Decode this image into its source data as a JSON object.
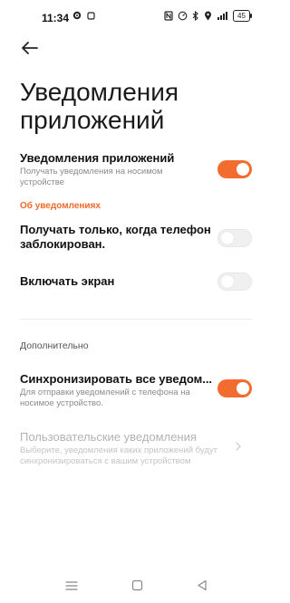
{
  "status_bar": {
    "time": "11:34",
    "battery": "45",
    "icons": [
      "gear-icon",
      "square-icon",
      "nfc-icon",
      "speedometer-icon",
      "bluetooth-icon",
      "location-icon",
      "signal-icon"
    ]
  },
  "header": {
    "title": "Уведомления приложений"
  },
  "settings": {
    "app_notifications": {
      "title": "Уведомления приложений",
      "subtitle_line1": "Получать уведомления на носимом",
      "subtitle_line2": "устройстве",
      "enabled": true
    },
    "section_about": "Об уведомлениях",
    "only_when_locked": {
      "title_line1": "Получать только, когда телефон",
      "title_line2": "заблокирован.",
      "enabled": false
    },
    "turn_on_screen": {
      "title": "Включать экран",
      "enabled": false
    },
    "section_additional": "Дополнительно",
    "sync_all": {
      "title": "Синхронизировать все уведом...",
      "subtitle_line1": "Для отправки уведомлений с телефона на",
      "subtitle_line2": "носимое устройство.",
      "enabled": true
    },
    "custom_notifications": {
      "title": "Пользовательские уведомления",
      "subtitle_line1": "Выберите, уведомления каких приложений будут",
      "subtitle_line2": "синхронизироваться с вашим устройством"
    }
  },
  "colors": {
    "accent": "#f36c2f",
    "section_orange": "#f06a2a",
    "toggle_off": "#f0f0f0",
    "disabled_text": "#b3b3b3"
  },
  "nav_bar": {
    "buttons": [
      "menu-icon",
      "home-icon",
      "back-triangle-icon"
    ]
  }
}
